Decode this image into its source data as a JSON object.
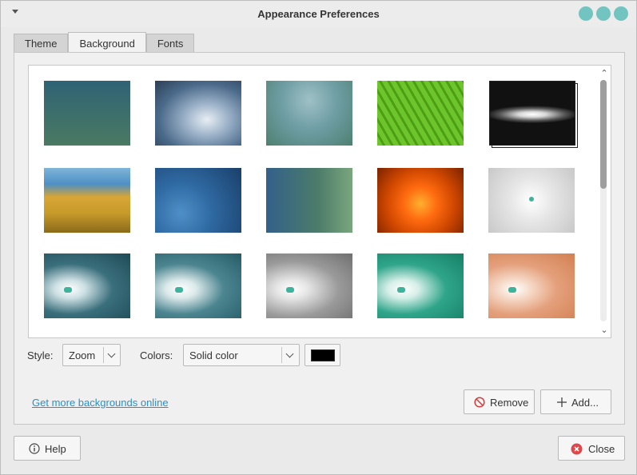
{
  "window": {
    "title": "Appearance Preferences",
    "control_color": "#72c4c0"
  },
  "tabs": [
    {
      "label": "Theme",
      "active": false
    },
    {
      "label": "Background",
      "active": true
    },
    {
      "label": "Fonts",
      "active": false
    }
  ],
  "style": {
    "label": "Style:",
    "value": "Zoom"
  },
  "colors": {
    "label": "Colors:",
    "value": "Solid color",
    "swatch": "#000000"
  },
  "online_link": "Get more backgrounds online",
  "buttons": {
    "remove": "Remove",
    "add": "Add...",
    "help": "Help",
    "close": "Close"
  },
  "icons": {
    "remove": "no-entry-icon",
    "add": "plus-icon",
    "help": "info-icon",
    "close": "close-circle-icon"
  },
  "wallpapers": [
    "teal-green gradient",
    "water droplet",
    "teal waves",
    "green leaf",
    "sombrero galaxy",
    "beach grass",
    "blue bubbles",
    "blue-green bokeh",
    "orange flower",
    "grey with mint logo",
    "dark teal vignette",
    "teal vignette",
    "grey vignette",
    "green vignette",
    "orange vignette"
  ]
}
